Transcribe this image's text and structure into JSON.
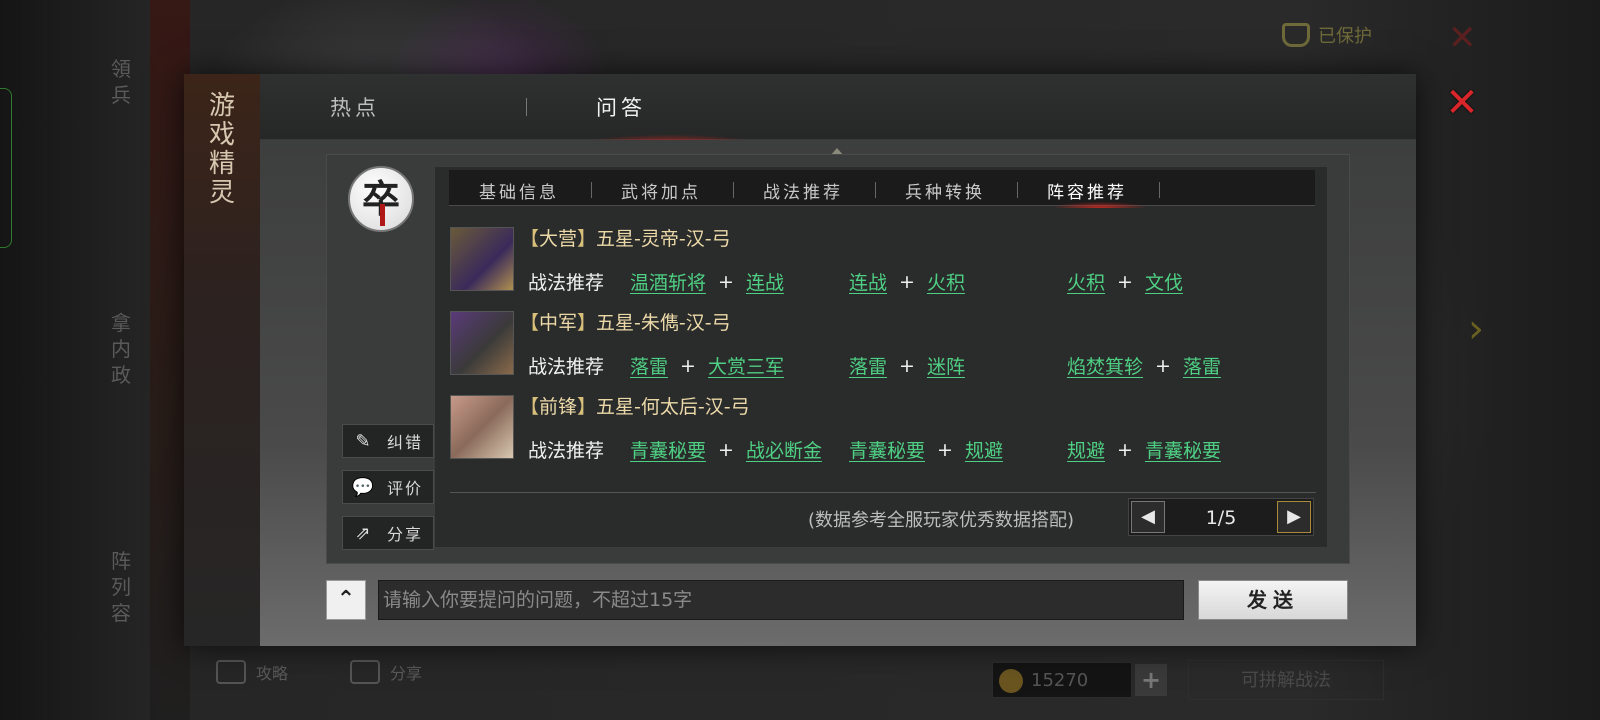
{
  "background": {
    "left_vertical_text_1": "領兵",
    "left_vertical_text_2": "拿内政",
    "left_vertical_text_3": "阵列容",
    "protect_label": "已保护",
    "bottom_strategy": "攻略",
    "bottom_share": "分享",
    "currency_value": "15270",
    "action_button": "可拼解战法"
  },
  "modal": {
    "side_title": "游戏精灵",
    "tabs": [
      {
        "label": "热点",
        "active": false
      },
      {
        "label": "问答",
        "active": true
      }
    ],
    "badge_char": "卒",
    "side_buttons": [
      {
        "label": "纠错",
        "icon": "edit-icon"
      },
      {
        "label": "评价",
        "icon": "comment-icon"
      },
      {
        "label": "分享",
        "icon": "share-icon"
      }
    ],
    "sub_tabs": [
      {
        "label": "基础信息",
        "active": false
      },
      {
        "label": "武将加点",
        "active": false
      },
      {
        "label": "战法推荐",
        "active": false
      },
      {
        "label": "兵种转换",
        "active": false
      },
      {
        "label": "阵容推荐",
        "active": true
      }
    ],
    "heroes": [
      {
        "position": "大营",
        "name": "五星-灵帝-汉-弓",
        "rec_label": "战法推荐",
        "combos": [
          [
            "温酒斩将",
            "连战"
          ],
          [
            "连战",
            "火积"
          ],
          [
            "火积",
            "文伐"
          ]
        ]
      },
      {
        "position": "中军",
        "name": "五星-朱儁-汉-弓",
        "rec_label": "战法推荐",
        "combos": [
          [
            "落雷",
            "大赏三军"
          ],
          [
            "落雷",
            "迷阵"
          ],
          [
            "焰焚箕轸",
            "落雷"
          ]
        ]
      },
      {
        "position": "前锋",
        "name": "五星-何太后-汉-弓",
        "rec_label": "战法推荐",
        "combos": [
          [
            "青囊秘要",
            "战必断金"
          ],
          [
            "青囊秘要",
            "规避"
          ],
          [
            "规避",
            "青囊秘要"
          ]
        ]
      }
    ],
    "plus_sign": "+",
    "note": "(数据参考全服玩家优秀数据搭配)",
    "pager": {
      "current": "1",
      "total": "5",
      "text": "1/5"
    },
    "input_placeholder": "请输入你要提问的问题，不超过15字",
    "send_label": "发送",
    "colors": {
      "skill_link": "#4ecf83",
      "close": "#d8262a",
      "active_glow": "#c8281e"
    }
  }
}
